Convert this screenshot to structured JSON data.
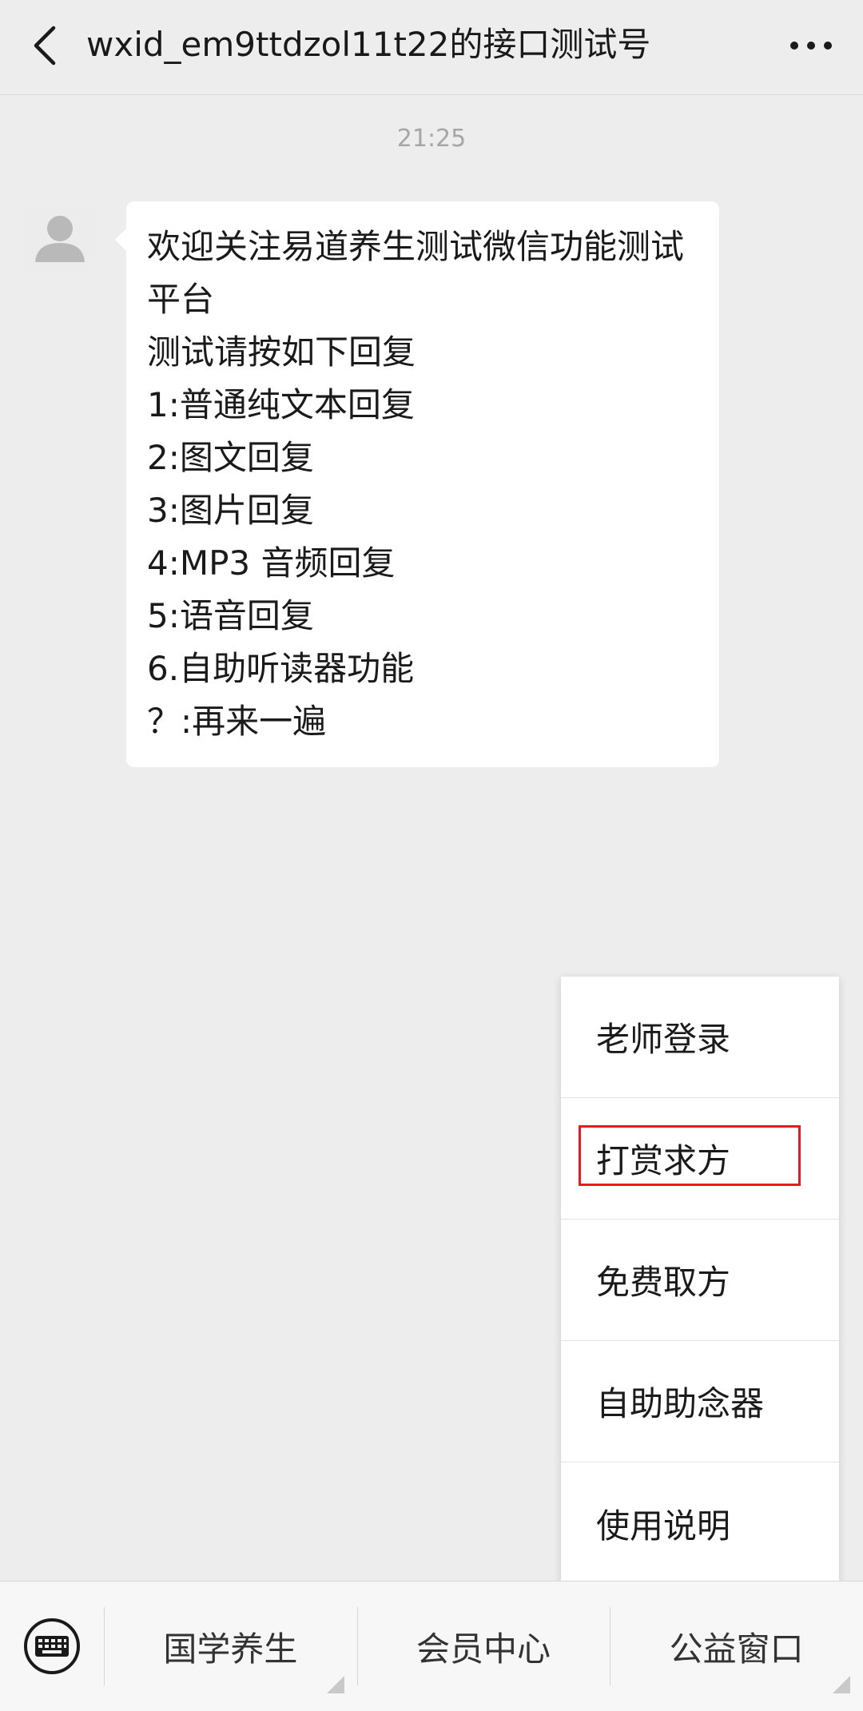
{
  "header": {
    "title": "wxid_em9ttdzol11t22的接口测试号",
    "back_icon": "chevron-left-icon",
    "more_icon": "more-dots-icon"
  },
  "chat": {
    "timestamp": "21:25",
    "message": {
      "lines": [
        "欢迎关注易道养生测试微信功能测试平台",
        "测试请按如下回复",
        "1:普通纯文本回复",
        "2:图文回复",
        "3:图片回复",
        "4:MP3 音频回复",
        "5:语音回复",
        "6.自助听读器功能",
        "？:再来一遍"
      ]
    }
  },
  "popup_menu": {
    "items": [
      {
        "label": "老师登录"
      },
      {
        "label": "打赏求方"
      },
      {
        "label": "免费取方"
      },
      {
        "label": "自助助念器"
      },
      {
        "label": "使用说明"
      }
    ],
    "highlight_color": "#e8191f"
  },
  "bottom_menu": {
    "keyboard_icon": "keyboard-icon",
    "tabs": [
      {
        "label": "国学养生"
      },
      {
        "label": "会员中心"
      },
      {
        "label": "公益窗口"
      }
    ]
  }
}
